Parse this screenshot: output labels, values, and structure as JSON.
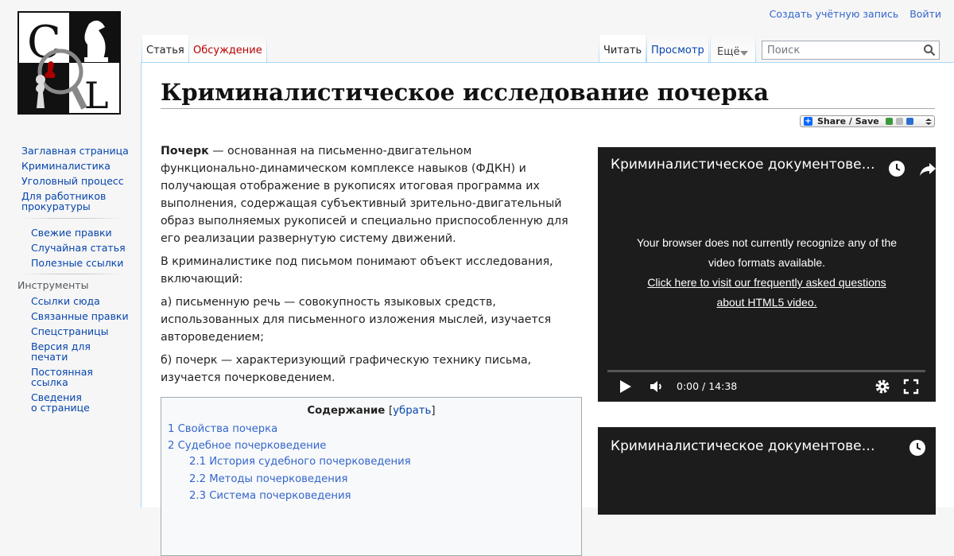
{
  "personal_tools": {
    "create_account": "Создать учётную запись",
    "login": "Войти"
  },
  "tabs": {
    "article": "Статья",
    "discussion": "Обсуждение",
    "read": "Читать",
    "view_source": "Просмотр",
    "more": "Ещё"
  },
  "search": {
    "placeholder": "Поиск"
  },
  "page": {
    "title": "Криминалистическое исследование почерка",
    "share_label": "Share / Save"
  },
  "body": {
    "p1_bold": "Почерк",
    "p1_rest": " — основанная на письменно-двигательном функционально-динамическом комплексе навыков (ФДКН) и получающая отображение в рукописях итоговая программа их выполнения, содержащая субъективный зрительно-двигательный образ выполняемых рукописей и специально приспособленную для его реализации развернутую систему движений.",
    "p2": "В криминалистике под письмом понимают объект исследования, включающий:",
    "p3": "а) письменную речь — совокупность языковых средств, использованных для письменного изложения мыслей, изучается автороведением;",
    "p4": "б) почерк — характеризующий графическую технику письма, изучается почерковедением."
  },
  "toc": {
    "title": "Содержание",
    "toggle_open": "[",
    "toggle": "убрать",
    "toggle_close": "]",
    "items": [
      {
        "num": "1",
        "label": "Свойства почерка"
      },
      {
        "num": "2",
        "label": "Судебное почерковедение"
      },
      {
        "num": "2.1",
        "label": "История судебного почерковедения"
      },
      {
        "num": "2.2",
        "label": "Методы почерковедения"
      },
      {
        "num": "2.3",
        "label": "Система почерковедения"
      }
    ]
  },
  "video1": {
    "title": "Криминалистическое документоведение",
    "msg_line1": "Your browser does not currently recognize any of the",
    "msg_line2": "video formats available.",
    "link_line1": "Click here to visit our frequently asked questions",
    "link_line2": "about HTML5 video.",
    "time": "0:00 / 14:38"
  },
  "video2": {
    "title": "Криминалистическое документоведение"
  },
  "sidebar": {
    "nav": [
      "Заглавная страница",
      "Криминалистика",
      "Уголовный процесс",
      "Для работников",
      "прокуратуры"
    ],
    "nav2": [
      "Свежие правки",
      "Случайная статья",
      "Полезные ссылки"
    ],
    "tools_heading": "Инструменты",
    "tools": [
      "Ссылки сюда",
      "Связанные правки",
      "Спецстраницы",
      "Версия для",
      "печати",
      "Постоянная",
      "ссылка",
      "Сведения",
      "о странице"
    ]
  }
}
